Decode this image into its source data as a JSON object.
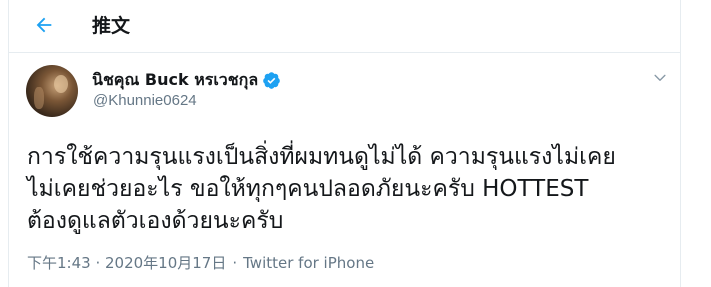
{
  "colors": {
    "accent": "#1da1f2",
    "text_primary": "#14171a",
    "text_secondary": "#657786",
    "border": "#e6ecf0"
  },
  "header": {
    "back_icon": "arrow-left-icon",
    "title": "推文"
  },
  "tweet": {
    "author_name": "นิชคุณ Buck หรเวชกุล",
    "verified_icon": "verified-badge-icon",
    "handle": "@Khunnie0624",
    "menu_icon": "chevron-down-icon",
    "text": "การใช้ความรุนแรงเป็นสิ่งที่ผมทนดูไม่ได้ ความรุนแรงไม่เคย\nไม่เคยช่วยอะไร ขอให้ทุกๆคนปลอดภัยนะครับ HOTTEST\nต้องดูแลตัวเองด้วยนะครับ",
    "timestamp": "下午1:43 · 2020年10月17日",
    "separator": "·",
    "source": "Twitter for iPhone"
  }
}
